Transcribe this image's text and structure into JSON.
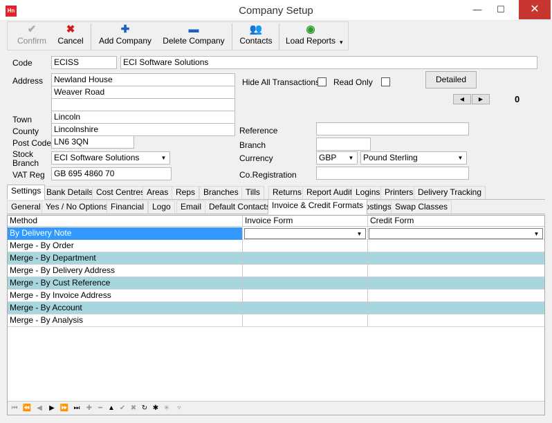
{
  "window": {
    "title": "Company Setup",
    "app_icon": "Hn",
    "minimize": "—",
    "maximize": "☐",
    "close": "✕"
  },
  "toolbar": {
    "confirm": "Confirm",
    "cancel": "Cancel",
    "add_company": "Add Company",
    "delete_company": "Delete Company",
    "contacts": "Contacts",
    "load_reports": "Load Reports"
  },
  "form": {
    "code_label": "Code",
    "code_value": "ECISS",
    "company_name": "ECI Software Solutions",
    "address_label": "Address",
    "address1": "Newland House",
    "address2": "Weaver Road",
    "address3": "",
    "town_label": "Town",
    "town": "Lincoln",
    "county_label": "County",
    "county": "Lincolnshire",
    "postcode_label": "Post Code",
    "postcode": "LN6 3QN",
    "stock_branch_label": "Stock Branch",
    "stock_branch": "ECI Software Solutions",
    "vat_label": "VAT Reg",
    "vat": "GB 695 4860 70",
    "hide_all_label": "Hide All Transactions",
    "read_only_label": "Read Only",
    "detailed_button": "Detailed",
    "counter": "0",
    "reference_label": "Reference",
    "reference": "",
    "branch_label": "Branch",
    "branch": "",
    "currency_label": "Currency",
    "currency_code": "GBP",
    "currency_name": "Pound Sterling",
    "coreg_label": "Co.Registration",
    "coreg": ""
  },
  "tabs_main": [
    "Settings",
    "Bank Details",
    "Cost Centres",
    "Areas",
    "Reps",
    "Branches",
    "Tills",
    "Returns",
    "Report Audit",
    "Logins",
    "Printers",
    "Delivery Tracking"
  ],
  "tabs_sub": [
    "General",
    "Yes / No Options",
    "Financial",
    "Logo",
    "Email",
    "Default Contacts",
    "Invoice & Credit Formats",
    "Costings",
    "Swap Classes"
  ],
  "grid": {
    "columns": [
      "Method",
      "Invoice Form",
      "Credit Form"
    ],
    "rows": [
      "By Delivery Note",
      "Merge - By Order",
      "Merge - By Department",
      "Merge - By Delivery Address",
      "Merge - By Cust Reference",
      "Merge - By Invoice Address",
      "Merge - By Account",
      "Merge - By Analysis"
    ]
  },
  "colors": {
    "row_alt": "#a8d6de",
    "row_selected": "#3399ff",
    "close": "#c7372f"
  }
}
